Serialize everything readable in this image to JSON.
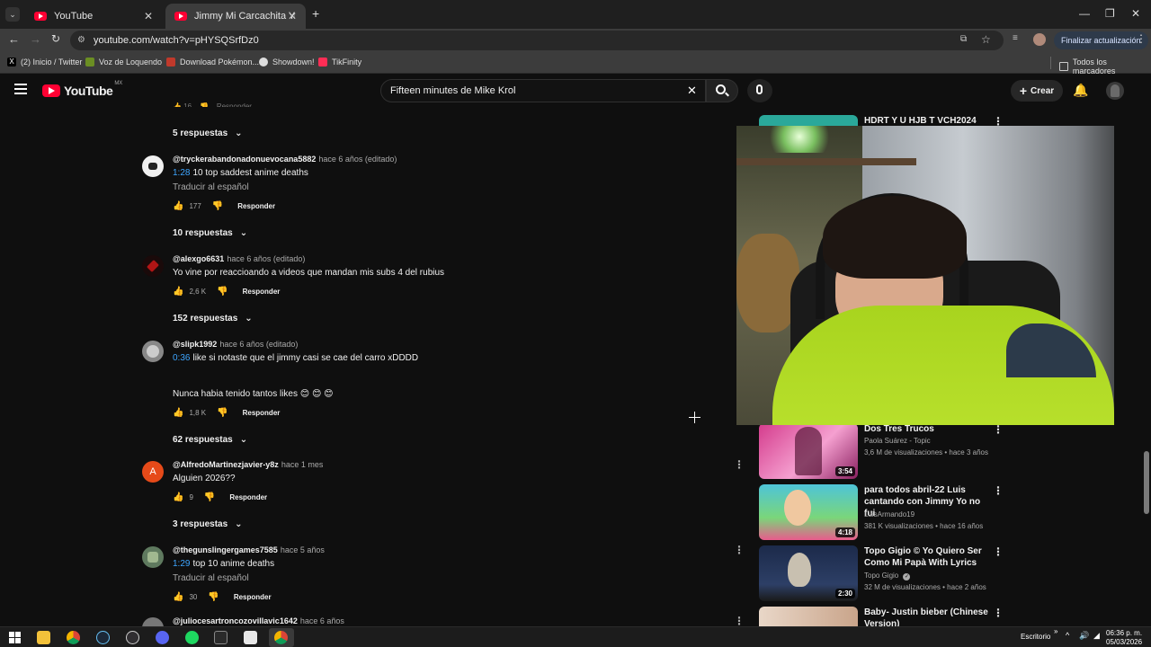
{
  "browser": {
    "tabs": [
      {
        "title": "YouTube"
      },
      {
        "title": "Jimmy Mi Carcachita Yega Reco"
      }
    ],
    "new_tab": "+",
    "url": "youtube.com/watch?v=pHYSQSrfDz0",
    "update_button": "Finalizar actualización",
    "bookmarks": [
      {
        "label": "(2) Inicio / Twitter",
        "color": "#000000"
      },
      {
        "label": "Voz de Loquendo",
        "color": "#6b8e23"
      },
      {
        "label": "Download Pokémon...",
        "color": "#c0392b"
      },
      {
        "label": "Showdown!",
        "color": "#dddddd"
      },
      {
        "label": "TikFinity",
        "color": "#ff2d55"
      }
    ],
    "all_bookmarks": "Todos los marcadores"
  },
  "youtube": {
    "logo_text": "YouTube",
    "region": "MX",
    "search_value": "Fifteen minutes de Mike Krol",
    "create_label": "Crear"
  },
  "comments": {
    "top_replies": "5 respuestas",
    "items": [
      {
        "user": "@tryckerabandonadonuevocana5882",
        "time": "hace 6 años (editado)",
        "timestamp": "1:28",
        "text": "10 top saddest anime deaths",
        "translate": "Traducir al español",
        "likes": "177",
        "reply": "Responder",
        "replies": "10 respuestas"
      },
      {
        "user": "@alexgo6631",
        "time": "hace 6 años (editado)",
        "timestamp": "",
        "text": "Yo vine por reaccioando a videos que mandan mis subs 4 del rubius",
        "translate": "",
        "likes": "2,6 K",
        "reply": "Responder",
        "replies": "152 respuestas"
      },
      {
        "user": "@slipk1992",
        "time": "hace 6 años (editado)",
        "timestamp": "0:36",
        "text": "like si notaste que el jimmy casi se cae del carro xDDDD",
        "text2": "Nunca habia tenido tantos likes 😊 😊 😊",
        "translate": "",
        "likes": "1,8 K",
        "reply": "Responder",
        "replies": "62 respuestas"
      },
      {
        "user": "@AlfredoMartinezjavier-y8z",
        "time": "hace 1 mes",
        "timestamp": "",
        "text": "Alguien 2026??",
        "translate": "",
        "likes": "9",
        "reply": "Responder",
        "replies": "3 respuestas",
        "avatar_letter": "A"
      },
      {
        "user": "@thegunslingergames7585",
        "time": "hace 5 años",
        "timestamp": "1:29",
        "text": "top 10 anime deaths",
        "translate": "Traducir al español",
        "likes": "30",
        "reply": "Responder",
        "replies": ""
      },
      {
        "user": "@juliocesartroncozovillavic1642",
        "time": "hace 6 años",
        "timestamp": "",
        "text": "",
        "translate": "",
        "likes": "",
        "reply": "",
        "replies": ""
      }
    ]
  },
  "sidebar": {
    "videos": [
      {
        "title": "HDRT Y U HJB T VCH2024",
        "channel": "",
        "meta": "",
        "duration": ""
      },
      {
        "title": "Dos Tres Trucos",
        "channel": "Paola Suárez - Topic",
        "meta": "3,6 M de visualizaciones • hace 3 años",
        "duration": "3:54"
      },
      {
        "title": "para todos abril-22 Luis cantando con Jimmy Yo no fui",
        "channel": "LuisArmando19",
        "meta": "381 K visualizaciones • hace 16 años",
        "duration": "4:18"
      },
      {
        "title": "Topo Gigio © Yo Quiero Ser Como Mi Papà With Lyrics",
        "channel": "Topo Gigio",
        "meta": "32 M de visualizaciones • hace 2 años",
        "duration": "2:30"
      },
      {
        "title": "Baby- Justin bieber (Chinese Version)",
        "channel": "",
        "meta": "",
        "duration": ""
      }
    ]
  },
  "taskbar": {
    "desktop_label": "Escritorio",
    "time": "06:36 p. m.",
    "date": "05/03/2026"
  }
}
